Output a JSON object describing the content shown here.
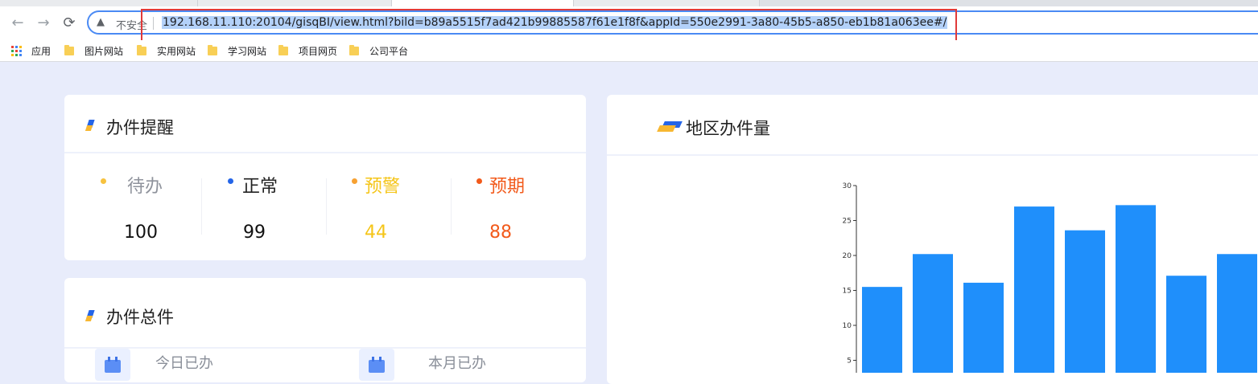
{
  "browser": {
    "security_label": "不安全",
    "url": "192.168.11.110:20104/gisqBI/view.html?bild=b89a5515f7ad421b99885587f61e1f8f&appId=550e2991-3a80-45b5-a850-eb1b81a063ee#/",
    "bookmarks": [
      "应用",
      "图片网站",
      "实用网站",
      "学习网站",
      "项目网页",
      "公司平台"
    ],
    "icons": {
      "back": "arrow-left-icon",
      "forward": "arrow-right-icon",
      "reload": "reload-icon",
      "warning": "warning-icon"
    }
  },
  "reminder": {
    "title": "办件提醒",
    "stats": [
      {
        "label": "待办",
        "value": "100",
        "label_color": "#8f939c",
        "value_color": "#111111",
        "dot_color": "#f7c23f"
      },
      {
        "label": "正常",
        "value": "99",
        "label_color": "#222222",
        "value_color": "#111111",
        "dot_color": "#2465e8"
      },
      {
        "label": "预警",
        "value": "44",
        "label_color": "#f5c518",
        "value_color": "#f5c518",
        "dot_color": "#f7a132"
      },
      {
        "label": "预期",
        "value": "88",
        "label_color": "#f25a1b",
        "value_color": "#f25a1b",
        "dot_color": "#f25a1b"
      }
    ]
  },
  "total": {
    "title": "办件总件",
    "items": [
      {
        "label": "今日已办"
      },
      {
        "label": "本月已办"
      }
    ]
  },
  "region": {
    "title": "地区办件量"
  },
  "chart_data": {
    "type": "bar",
    "values": [
      15.5,
      20.2,
      16.1,
      27.0,
      23.6,
      27.2,
      17.1,
      20.2
    ],
    "yticks": [
      "5",
      "10",
      "15",
      "20",
      "25",
      "30"
    ],
    "ylim": [
      0,
      30
    ],
    "grid": false,
    "color": "#1f8ffb"
  }
}
